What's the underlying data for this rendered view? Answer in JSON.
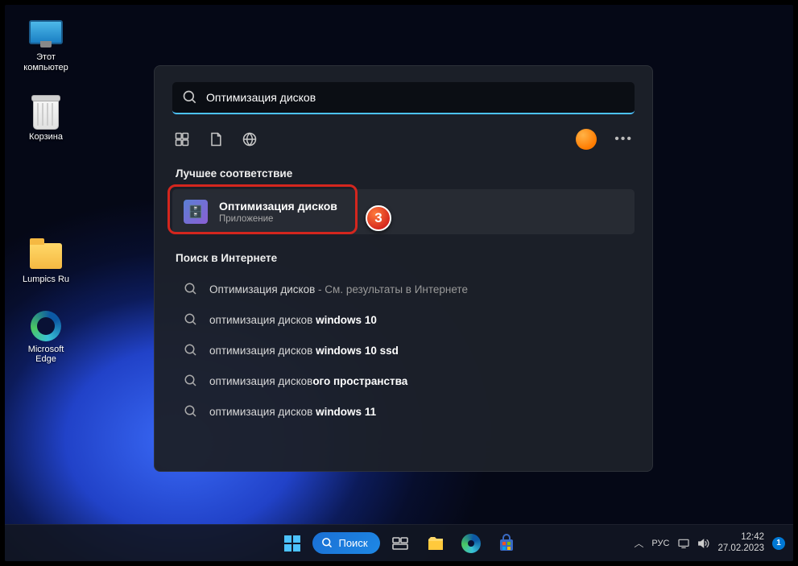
{
  "desktop": {
    "icons": [
      {
        "label": "Этот компьютер",
        "name": "desktop-icon-this-pc"
      },
      {
        "label": "Корзина",
        "name": "desktop-icon-recycle-bin"
      },
      {
        "label": "Lumpics Ru",
        "name": "desktop-icon-lumpics"
      },
      {
        "label": "Microsoft Edge",
        "name": "desktop-icon-edge"
      }
    ]
  },
  "search": {
    "query": "Оптимизация дисков",
    "section_best": "Лучшее соответствие",
    "best_match": {
      "title": "Оптимизация дисков",
      "subtitle": "Приложение"
    },
    "section_web": "Поиск в Интернете",
    "web_results": [
      {
        "prefix": "Оптимизация дисков",
        "bold": "",
        "suffix": " - См. результаты в Интернете"
      },
      {
        "prefix": "оптимизация дисков ",
        "bold": "windows 10",
        "suffix": ""
      },
      {
        "prefix": "оптимизация дисков ",
        "bold": "windows 10 ssd",
        "suffix": ""
      },
      {
        "prefix": "оптимизация дисков",
        "bold": "ого пространства",
        "suffix": ""
      },
      {
        "prefix": "оптимизация дисков ",
        "bold": "windows 11",
        "suffix": ""
      }
    ]
  },
  "annotation": {
    "step": "3"
  },
  "taskbar": {
    "search_label": "Поиск",
    "lang": "РУС",
    "time": "12:42",
    "date": "27.02.2023",
    "notif_count": "1"
  }
}
